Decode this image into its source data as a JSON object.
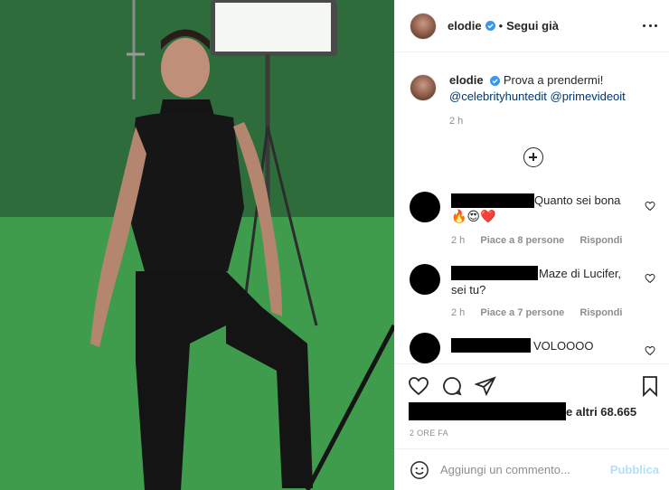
{
  "post": {
    "username": "elodie",
    "follow_status": "Segui già",
    "more_icon": "more-options-icon"
  },
  "caption": {
    "username": "elodie",
    "text": "Prova a prendermi!",
    "mention_1": "@celebrityhuntedit",
    "mention_2": "@primevideoit",
    "time": "2 h"
  },
  "comments": [
    {
      "text": "Quanto sei bona",
      "emojis": "🔥😍❤️",
      "time": "2 h",
      "likes": "Piace a 8 persone",
      "reply": "Rispondi"
    },
    {
      "text_line1": "Maze di Lucifer,",
      "text_line2": "sei tu?",
      "time": "2 h",
      "likes": "Piace a 7 persone",
      "reply": "Rispondi"
    },
    {
      "text": "VOLOOOO"
    }
  ],
  "likes_suffix": "e altri 68.665",
  "date": "2 ORE FA",
  "comment_input": {
    "placeholder": "Aggiungi un commento..."
  },
  "publish_label": "Pubblica",
  "colors": {
    "link": "#00376b",
    "muted": "#8e8e8e",
    "publish": "#b2dffc",
    "verified": "#3897f0"
  }
}
